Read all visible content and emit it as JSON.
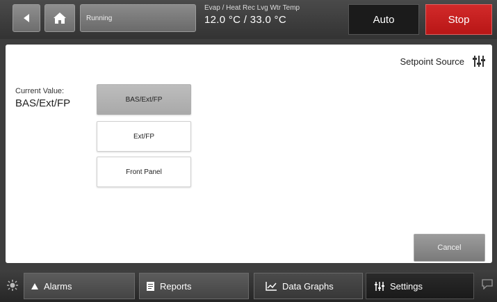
{
  "topbar": {
    "status": "Running",
    "temp_label": "Evap / Heat Rec Lvg Wtr Temp",
    "temp_value": "12.0 °C / 33.0 °C",
    "auto_label": "Auto",
    "stop_label": "Stop"
  },
  "main": {
    "title": "Setpoint Source",
    "current_label": "Current Value:",
    "current_value": "BAS/Ext/FP",
    "options": [
      "BAS/Ext/FP",
      "Ext/FP",
      "Front Panel"
    ],
    "selected_option": "BAS/Ext/FP",
    "cancel_label": "Cancel"
  },
  "bottombar": {
    "tabs": [
      {
        "label": "Alarms",
        "icon": "alarm-triangle-icon"
      },
      {
        "label": "Reports",
        "icon": "document-icon"
      },
      {
        "label": "Data Graphs",
        "icon": "graph-icon"
      },
      {
        "label": "Settings",
        "icon": "sliders-icon"
      }
    ]
  },
  "colors": {
    "stop": "#c41e1e",
    "auto_bg": "#1b1b1b",
    "panel_bg": "#ffffff",
    "selected_option_bg": "#b3b3b3"
  }
}
